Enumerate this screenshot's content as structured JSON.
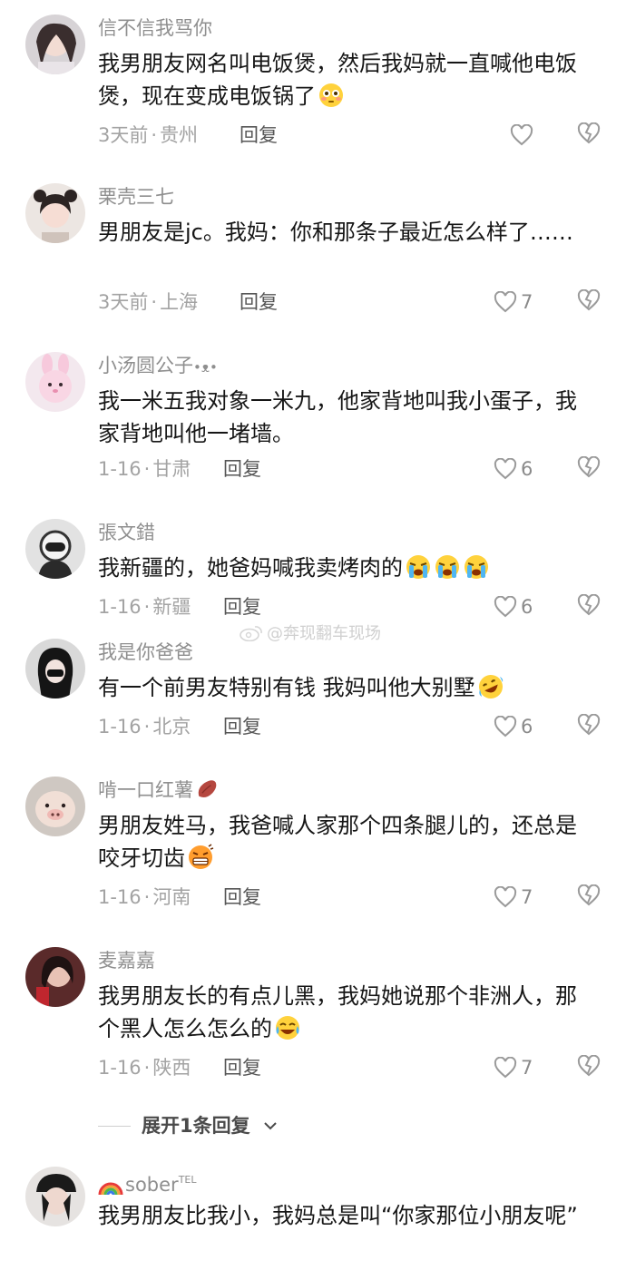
{
  "watermark": "@奔现翻车现场",
  "expand_replies": {
    "label": "展开1条回复"
  },
  "reply_label": "回复",
  "comments": [
    {
      "username": "信不信我骂你",
      "text": "我男朋友网名叫电饭煲，然后我妈就一直喊他电饭煲，现在变成电饭锅了",
      "emoji": [
        "flushed-face-emoji"
      ],
      "date": "3天前",
      "location": "贵州",
      "likes": ""
    },
    {
      "username": "栗壳三七",
      "text": "男朋友是jc。我妈：你和那条子最近怎么样了……",
      "emoji": [],
      "date": "3天前",
      "location": "上海",
      "likes": "7"
    },
    {
      "username": "小汤圆公子",
      "username_suffix": "•ᴥ•",
      "text": "我一米五我对象一米九，他家背地叫我小蛋子，我家背地叫他一堵墙。",
      "emoji": [],
      "date": "1-16",
      "location": "甘肃",
      "likes": "6"
    },
    {
      "username": "張文錯",
      "text": "我新疆的，她爸妈喊我卖烤肉的",
      "emoji": [
        "loudly-crying-face-emoji",
        "loudly-crying-face-emoji",
        "loudly-crying-face-emoji"
      ],
      "date": "1-16",
      "location": "新疆",
      "likes": "6"
    },
    {
      "username": "我是你爸爸",
      "text": "有一个前男友特别有钱 我妈叫他大别墅",
      "emoji": [
        "rolling-laughing-face-emoji"
      ],
      "date": "1-16",
      "location": "北京",
      "likes": "6"
    },
    {
      "username": "啃一口红薯",
      "text": "男朋友姓马，我爸喊人家那个四条腿儿的，还总是咬牙切齿",
      "emoji": [
        "grimacing-face-emoji"
      ],
      "date": "1-16",
      "location": "河南",
      "likes": "7"
    },
    {
      "username": "麦嘉嘉",
      "text": "我男朋友长的有点儿黑，我妈她说那个非洲人，那个黑人怎么怎么的",
      "emoji": [
        "tears-of-joy-emoji"
      ],
      "date": "1-16",
      "location": "陕西",
      "likes": "7"
    },
    {
      "username": "sober",
      "username_sup": "TEL",
      "text": "我男朋友比我小，我妈总是叫“你家那位小朋友呢”",
      "emoji": [],
      "date": "",
      "location": "",
      "likes": ""
    }
  ],
  "colors": {
    "username": "#8f8f8f",
    "text": "#161616",
    "meta": "#a3a3a3",
    "reply": "#565656",
    "icon": "#9a9a9a"
  }
}
